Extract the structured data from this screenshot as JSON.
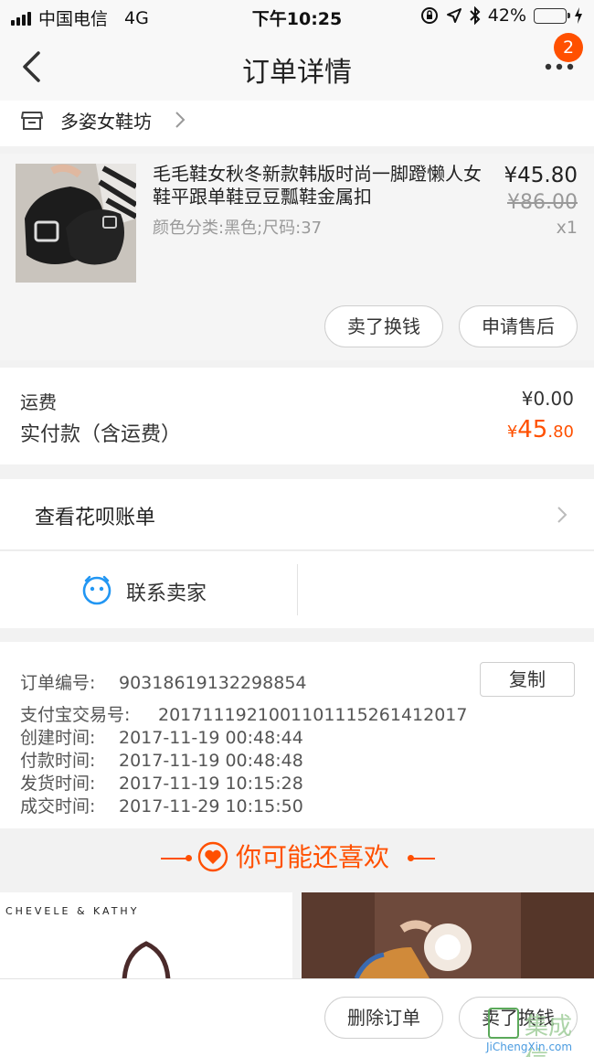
{
  "status_bar": {
    "carrier": "中国电信",
    "network": "4G",
    "time": "下午10:25",
    "battery_percent": "42%",
    "battery_level": 0.42
  },
  "nav": {
    "title": "订单详情",
    "badge_count": "2"
  },
  "shop": {
    "name": "多姿女鞋坊"
  },
  "item": {
    "title": "毛毛鞋女秋冬新款韩版时尚一脚蹬懒人女鞋平跟单鞋豆豆瓢鞋金属扣",
    "spec": "颜色分类:黑色;尺码:37",
    "price": "¥45.80",
    "original_price": "¥86.00",
    "quantity": "x1",
    "actions": [
      "卖了换钱",
      "申请售后"
    ]
  },
  "fees": {
    "shipping_label": "运费",
    "shipping_value": "¥0.00",
    "paid_label": "实付款（含运费）",
    "paid_currency": "¥",
    "paid_int": "45",
    "paid_dec": ".80"
  },
  "huabei": {
    "label": "查看花呗账单"
  },
  "contact": {
    "label": "联系卖家"
  },
  "order_info": {
    "copy_label": "复制",
    "rows": [
      {
        "key": "订单编号:",
        "value": "90318619132298854"
      },
      {
        "key": "支付宝交易号:",
        "value": "2017111921001101115261412017"
      },
      {
        "key": "创建时间:",
        "value": "2017-11-19 00:48:44"
      },
      {
        "key": "付款时间:",
        "value": "2017-11-19 00:48:48"
      },
      {
        "key": "发货时间:",
        "value": "2017-11-19 10:15:28"
      },
      {
        "key": "成交时间:",
        "value": "2017-11-29 10:15:50"
      }
    ]
  },
  "recommend": {
    "title": "你可能还喜欢",
    "brand_text": "CHEVELE & KATHY"
  },
  "bottom_actions": [
    "删除订单",
    "卖了换钱"
  ],
  "watermark": {
    "text": "集成信",
    "url": "JiChengXin.com"
  },
  "colors": {
    "accent": "#ff5000",
    "battery": "#4cd964",
    "contact_icon": "#2196f3"
  }
}
